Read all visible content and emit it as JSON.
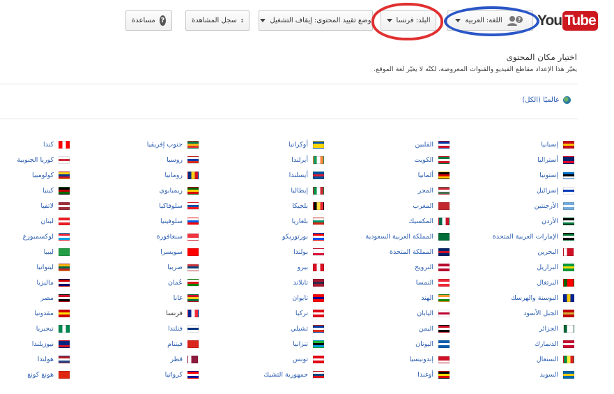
{
  "header": {
    "logo": {
      "you": "You",
      "tube": "Tube"
    },
    "language_button": "اللغة: العربية",
    "country_button": "البلد: فرنسا",
    "restricted_button": "وضع تقييد المحتوى: إيقاف التشغيل",
    "history_button": "سجل المشاهدة",
    "help_button": "مساعدة"
  },
  "content": {
    "heading": "اختيار مكان المحتوى",
    "subheading": "يغيّر هذا الإعداد مقاطع الفيديو والقنوات المعروضة، لكنّه لا يغيّر لغة الموقع.",
    "worldwide_label": "عالميًا (الكل)"
  },
  "columns": [
    [
      {
        "name": "إسبانيا",
        "colors": [
          "#c60b1e",
          "#ffc400",
          "#c60b1e"
        ],
        "dir": "h"
      },
      {
        "name": "أستراليا",
        "colors": [
          "#012169",
          "#012169",
          "#e4002b"
        ],
        "dir": "h"
      },
      {
        "name": "إستونيا",
        "colors": [
          "#0072ce",
          "#000000",
          "#ffffff"
        ],
        "dir": "h"
      },
      {
        "name": "إسرائيل",
        "colors": [
          "#ffffff",
          "#0038b8",
          "#ffffff"
        ],
        "dir": "h"
      },
      {
        "name": "الأرجنتين",
        "colors": [
          "#74acdf",
          "#ffffff",
          "#74acdf"
        ],
        "dir": "h"
      },
      {
        "name": "الأردن",
        "colors": [
          "#000000",
          "#ffffff",
          "#007a3d"
        ],
        "dir": "h"
      },
      {
        "name": "الإمارات العربية المتحدة",
        "colors": [
          "#00732f",
          "#ffffff",
          "#000000"
        ],
        "dir": "h"
      },
      {
        "name": "البحرين",
        "colors": [
          "#ffffff",
          "#ce1126",
          "#ce1126"
        ],
        "dir": "v"
      },
      {
        "name": "البرازيل",
        "colors": [
          "#009c3b",
          "#ffdf00",
          "#009c3b"
        ],
        "dir": "h"
      },
      {
        "name": "البرتغال",
        "colors": [
          "#006600",
          "#ff0000",
          "#ff0000"
        ],
        "dir": "v"
      },
      {
        "name": "البوسنة والهرسك",
        "colors": [
          "#002395",
          "#fecb00",
          "#002395"
        ],
        "dir": "v"
      },
      {
        "name": "الجبل الأسود",
        "colors": [
          "#c40308",
          "#d3ae3b",
          "#c40308"
        ],
        "dir": "h"
      },
      {
        "name": "الجزائر",
        "colors": [
          "#006233",
          "#ffffff",
          "#ffffff"
        ],
        "dir": "v"
      },
      {
        "name": "الدنمارك",
        "colors": [
          "#c60c30",
          "#ffffff",
          "#c60c30"
        ],
        "dir": "h"
      },
      {
        "name": "السنغال",
        "colors": [
          "#00853f",
          "#fdef42",
          "#e31b23"
        ],
        "dir": "v"
      },
      {
        "name": "السويد",
        "colors": [
          "#006aa7",
          "#fecc00",
          "#006aa7"
        ],
        "dir": "h"
      }
    ],
    [
      {
        "name": "الفلبين",
        "colors": [
          "#0038a8",
          "#ffffff",
          "#ce1126"
        ],
        "dir": "h"
      },
      {
        "name": "الكويت",
        "colors": [
          "#007a3d",
          "#ffffff",
          "#ce1126"
        ],
        "dir": "h"
      },
      {
        "name": "ألمانيا",
        "colors": [
          "#000000",
          "#dd0000",
          "#ffce00"
        ],
        "dir": "h"
      },
      {
        "name": "المجر",
        "colors": [
          "#ce2939",
          "#ffffff",
          "#477050"
        ],
        "dir": "h"
      },
      {
        "name": "المغرب",
        "colors": [
          "#c1272d",
          "#c1272d",
          "#c1272d"
        ],
        "dir": "h"
      },
      {
        "name": "المكسيك",
        "colors": [
          "#006847",
          "#ffffff",
          "#ce1126"
        ],
        "dir": "v"
      },
      {
        "name": "المملكة العربية السعودية",
        "colors": [
          "#006c35",
          "#006c35",
          "#006c35"
        ],
        "dir": "h"
      },
      {
        "name": "المملكة المتحدة",
        "colors": [
          "#012169",
          "#c8102e",
          "#012169"
        ],
        "dir": "h"
      },
      {
        "name": "النرويج",
        "colors": [
          "#ba0c2f",
          "#ffffff",
          "#ba0c2f"
        ],
        "dir": "h"
      },
      {
        "name": "النمسا",
        "colors": [
          "#ed2939",
          "#ffffff",
          "#ed2939"
        ],
        "dir": "h"
      },
      {
        "name": "الهند",
        "colors": [
          "#ff9933",
          "#ffffff",
          "#138808"
        ],
        "dir": "h"
      },
      {
        "name": "اليابان",
        "colors": [
          "#ffffff",
          "#bc002d",
          "#ffffff"
        ],
        "dir": "h"
      },
      {
        "name": "اليمن",
        "colors": [
          "#ce1126",
          "#ffffff",
          "#000000"
        ],
        "dir": "h"
      },
      {
        "name": "اليونان",
        "colors": [
          "#0d5eaf",
          "#ffffff",
          "#0d5eaf"
        ],
        "dir": "h"
      },
      {
        "name": "إندونيسيا",
        "colors": [
          "#ce1126",
          "#ce1126",
          "#ffffff"
        ],
        "dir": "h"
      },
      {
        "name": "أوغندا",
        "colors": [
          "#000000",
          "#fcdc04",
          "#d90000"
        ],
        "dir": "h"
      }
    ],
    [
      {
        "name": "أوكرانيا",
        "colors": [
          "#0057b7",
          "#ffd700",
          "#ffd700"
        ],
        "dir": "h"
      },
      {
        "name": "أيرلندا",
        "colors": [
          "#169b62",
          "#ffffff",
          "#ff883e"
        ],
        "dir": "v"
      },
      {
        "name": "أيسلندا",
        "colors": [
          "#02529c",
          "#dc1e35",
          "#02529c"
        ],
        "dir": "h"
      },
      {
        "name": "إيطاليا",
        "colors": [
          "#009246",
          "#ffffff",
          "#ce2b37"
        ],
        "dir": "v"
      },
      {
        "name": "بلجيكا",
        "colors": [
          "#000000",
          "#fae042",
          "#ed2939"
        ],
        "dir": "v"
      },
      {
        "name": "بلغاريا",
        "colors": [
          "#ffffff",
          "#00966e",
          "#d62612"
        ],
        "dir": "h"
      },
      {
        "name": "بورتوريكو",
        "colors": [
          "#ed0000",
          "#ffffff",
          "#0050f0"
        ],
        "dir": "h"
      },
      {
        "name": "بولندا",
        "colors": [
          "#ffffff",
          "#ffffff",
          "#dc143c"
        ],
        "dir": "h"
      },
      {
        "name": "بيرو",
        "colors": [
          "#d91023",
          "#ffffff",
          "#d91023"
        ],
        "dir": "v"
      },
      {
        "name": "تايلاند",
        "colors": [
          "#a51931",
          "#2d2a4a",
          "#a51931"
        ],
        "dir": "h"
      },
      {
        "name": "تايوان",
        "colors": [
          "#fe0000",
          "#000095",
          "#fe0000"
        ],
        "dir": "h"
      },
      {
        "name": "تركيا",
        "colors": [
          "#e30a17",
          "#ffffff",
          "#e30a17"
        ],
        "dir": "h"
      },
      {
        "name": "تشيلي",
        "colors": [
          "#0039a6",
          "#ffffff",
          "#d52b1e"
        ],
        "dir": "h"
      },
      {
        "name": "تنزانيا",
        "colors": [
          "#1eb53a",
          "#000000",
          "#00a3dd"
        ],
        "dir": "h"
      },
      {
        "name": "تونس",
        "colors": [
          "#e70013",
          "#ffffff",
          "#e70013"
        ],
        "dir": "h"
      },
      {
        "name": "جمهورية التشيك",
        "colors": [
          "#ffffff",
          "#11457e",
          "#d7141a"
        ],
        "dir": "h"
      }
    ],
    [
      {
        "name": "جنوب إفريقيا",
        "colors": [
          "#007a4d",
          "#ffb612",
          "#de3831"
        ],
        "dir": "h"
      },
      {
        "name": "روسيا",
        "colors": [
          "#ffffff",
          "#0039a6",
          "#d52b1e"
        ],
        "dir": "h"
      },
      {
        "name": "رومانيا",
        "colors": [
          "#002b7f",
          "#fcd116",
          "#ce1126"
        ],
        "dir": "v"
      },
      {
        "name": "زيمبابوي",
        "colors": [
          "#006400",
          "#ffd200",
          "#d40000"
        ],
        "dir": "h"
      },
      {
        "name": "سلوفاكيا",
        "colors": [
          "#ffffff",
          "#0b4ea2",
          "#ee1c25"
        ],
        "dir": "h"
      },
      {
        "name": "سلوفينيا",
        "colors": [
          "#ffffff",
          "#005ce5",
          "#ff0000"
        ],
        "dir": "h"
      },
      {
        "name": "سنغافورة",
        "colors": [
          "#ef3340",
          "#ef3340",
          "#ffffff"
        ],
        "dir": "h"
      },
      {
        "name": "سويسرا",
        "colors": [
          "#ff0000",
          "#ff0000",
          "#ff0000"
        ],
        "dir": "h"
      },
      {
        "name": "صربيا",
        "colors": [
          "#c6363c",
          "#0c4076",
          "#ffffff"
        ],
        "dir": "h"
      },
      {
        "name": "عُمان",
        "colors": [
          "#ffffff",
          "#db161b",
          "#008000"
        ],
        "dir": "h"
      },
      {
        "name": "غانا",
        "colors": [
          "#ce1126",
          "#fcd116",
          "#006b3f"
        ],
        "dir": "h"
      },
      {
        "name": "فرنسا",
        "colors": [
          "#002395",
          "#ffffff",
          "#ed2939"
        ],
        "dir": "v",
        "selected": true
      },
      {
        "name": "فنلندا",
        "colors": [
          "#ffffff",
          "#003580",
          "#ffffff"
        ],
        "dir": "h"
      },
      {
        "name": "فيتنام",
        "colors": [
          "#da251d",
          "#da251d",
          "#da251d"
        ],
        "dir": "h"
      },
      {
        "name": "قطر",
        "colors": [
          "#ffffff",
          "#8d1b3d",
          "#8d1b3d"
        ],
        "dir": "v"
      },
      {
        "name": "كرواتيا",
        "colors": [
          "#ff0000",
          "#ffffff",
          "#171796"
        ],
        "dir": "h"
      }
    ],
    [
      {
        "name": "كندا",
        "colors": [
          "#ff0000",
          "#ffffff",
          "#ff0000"
        ],
        "dir": "v"
      },
      {
        "name": "كوريا الجنوبية",
        "colors": [
          "#ffffff",
          "#cd2e3a",
          "#ffffff"
        ],
        "dir": "h"
      },
      {
        "name": "كولومبيا",
        "colors": [
          "#fcd116",
          "#003893",
          "#ce1126"
        ],
        "dir": "h"
      },
      {
        "name": "كينيا",
        "colors": [
          "#000000",
          "#bb0000",
          "#006600"
        ],
        "dir": "h"
      },
      {
        "name": "لاتفيا",
        "colors": [
          "#9e3039",
          "#ffffff",
          "#9e3039"
        ],
        "dir": "h"
      },
      {
        "name": "لبنان",
        "colors": [
          "#ed1c24",
          "#ffffff",
          "#ed1c24"
        ],
        "dir": "h"
      },
      {
        "name": "لوكسمبورغ",
        "colors": [
          "#ed2939",
          "#ffffff",
          "#00a1de"
        ],
        "dir": "h"
      },
      {
        "name": "ليبيا",
        "colors": [
          "#239e46",
          "#239e46",
          "#239e46"
        ],
        "dir": "h"
      },
      {
        "name": "ليتوانيا",
        "colors": [
          "#fdb913",
          "#006a44",
          "#c1272d"
        ],
        "dir": "h"
      },
      {
        "name": "ماليزيا",
        "colors": [
          "#cc0001",
          "#ffffff",
          "#010066"
        ],
        "dir": "h"
      },
      {
        "name": "مصر",
        "colors": [
          "#ce1126",
          "#ffffff",
          "#000000"
        ],
        "dir": "h"
      },
      {
        "name": "مقدونيا",
        "colors": [
          "#d20000",
          "#ffe600",
          "#d20000"
        ],
        "dir": "h"
      },
      {
        "name": "نيجيريا",
        "colors": [
          "#008751",
          "#ffffff",
          "#008751"
        ],
        "dir": "v"
      },
      {
        "name": "نيوزيلندا",
        "colors": [
          "#00247d",
          "#00247d",
          "#cc142b"
        ],
        "dir": "h"
      },
      {
        "name": "هولندا",
        "colors": [
          "#ae1c28",
          "#ffffff",
          "#21468b"
        ],
        "dir": "h"
      },
      {
        "name": "هونغ كونغ",
        "colors": [
          "#de2910",
          "#de2910",
          "#de2910"
        ],
        "dir": "h"
      }
    ]
  ]
}
